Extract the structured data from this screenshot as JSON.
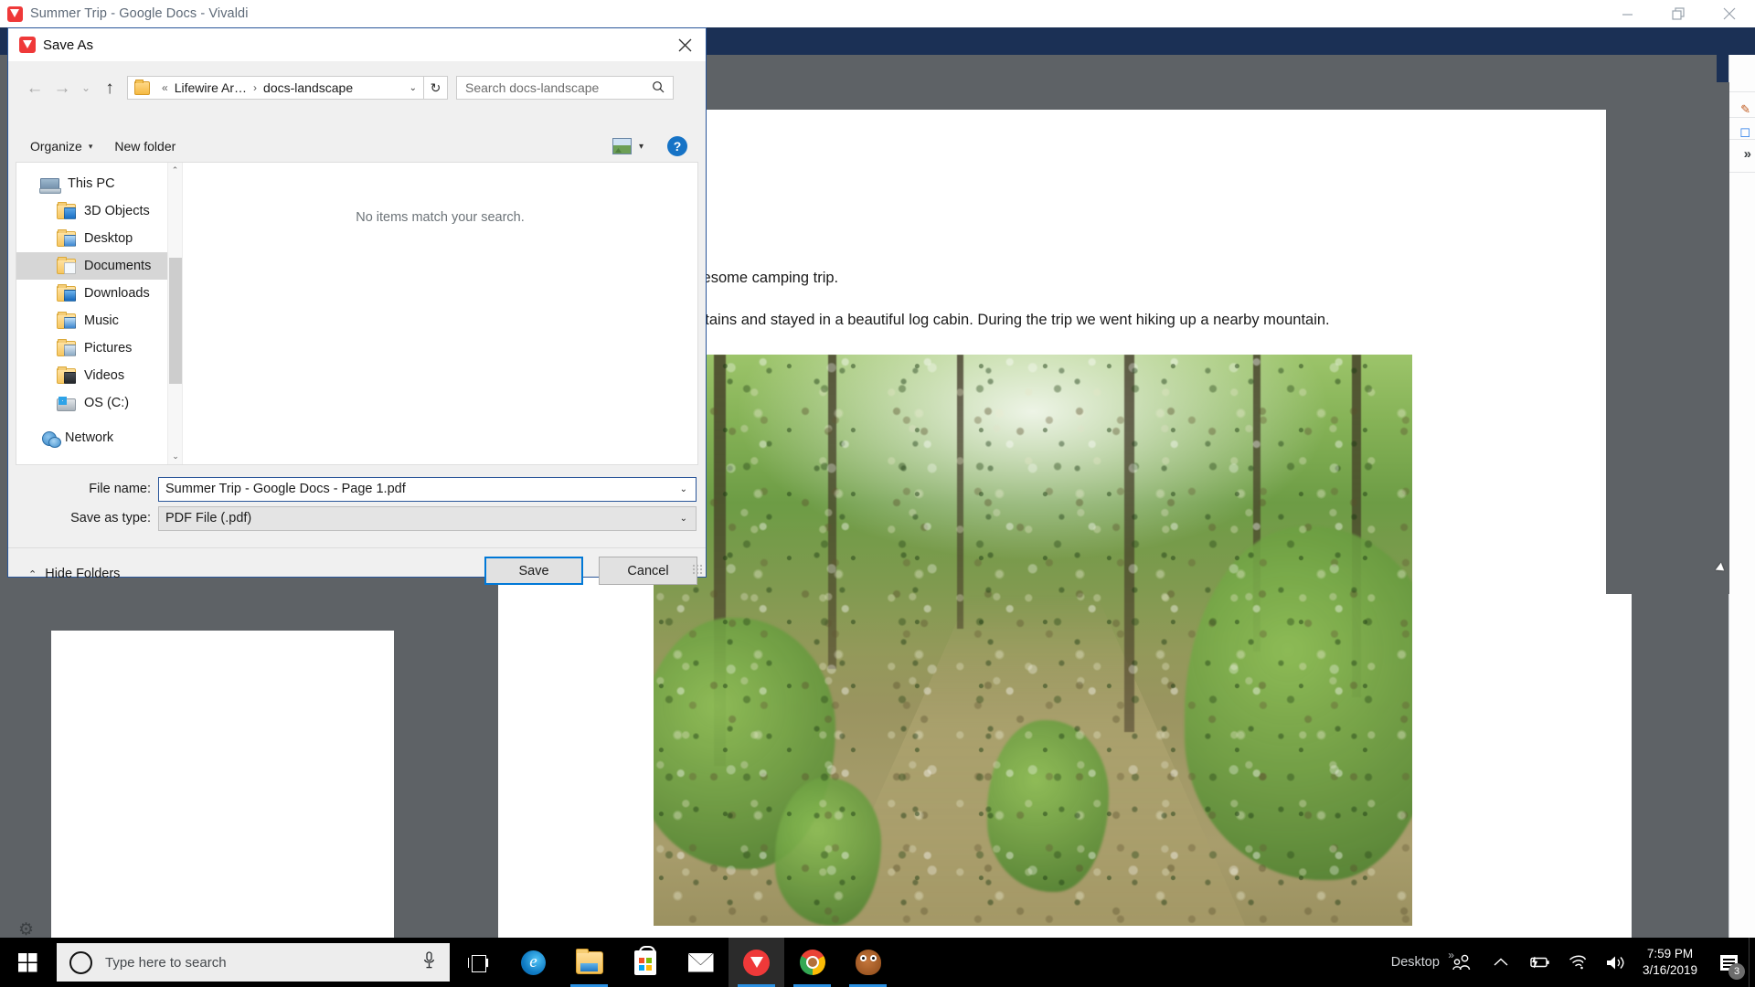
{
  "browser": {
    "title": "Summer Trip - Google Docs - Vivaldi",
    "app_icon": "vivaldi-icon",
    "window_controls": {
      "minimize": "minimize-icon",
      "maximize": "restore-icon",
      "close": "close-icon"
    }
  },
  "document": {
    "paragraph_1": "e took an awesome camping trip.",
    "paragraph_2": "Smoky Mountains and stayed in a beautiful log cabin. During the trip we went hiking up a nearby mountain.",
    "photo_alt": "forest-trail-photo"
  },
  "dialog": {
    "title": "Save As",
    "icon": "vivaldi-icon",
    "close_label": "✕",
    "nav": {
      "back": "←",
      "forward": "→",
      "recent": "⌄",
      "up": "↑",
      "refresh": "↻"
    },
    "address": {
      "folder_icon": "folder-icon",
      "crumb_overflow": "«",
      "crumb_1": "Lifewire Ar…",
      "crumb_sep": "›",
      "crumb_2": "docs-landscape",
      "dropdown_caret": "⌄"
    },
    "search": {
      "placeholder": "Search docs-landscape",
      "icon": "search-icon"
    },
    "commandbar": {
      "organize": "Organize",
      "organize_caret": "▾",
      "new_folder": "New folder",
      "view_icon": "view-layout-icon",
      "view_caret": "▾",
      "help": "?"
    },
    "nav_tree": [
      {
        "label": "This PC",
        "icon": "computer-icon",
        "level": 0,
        "selected": false
      },
      {
        "label": "3D Objects",
        "icon": "folder-3d-objects-icon",
        "level": 1,
        "selected": false
      },
      {
        "label": "Desktop",
        "icon": "folder-desktop-icon",
        "level": 1,
        "selected": false
      },
      {
        "label": "Documents",
        "icon": "folder-documents-icon",
        "level": 1,
        "selected": true
      },
      {
        "label": "Downloads",
        "icon": "folder-downloads-icon",
        "level": 1,
        "selected": false
      },
      {
        "label": "Music",
        "icon": "folder-music-icon",
        "level": 1,
        "selected": false
      },
      {
        "label": "Pictures",
        "icon": "folder-pictures-icon",
        "level": 1,
        "selected": false
      },
      {
        "label": "Videos",
        "icon": "folder-videos-icon",
        "level": 1,
        "selected": false
      },
      {
        "label": "OS (C:)",
        "icon": "drive-icon",
        "level": 1,
        "selected": false
      },
      {
        "label": "Network",
        "icon": "network-icon",
        "level": 0,
        "selected": false
      }
    ],
    "scrollbar": {
      "up_arrow": "⌃",
      "down_arrow": "⌄"
    },
    "file_list": {
      "empty_message": "No items match your search."
    },
    "form": {
      "filename_label": "File name:",
      "filename_value": "Summer Trip - Google Docs - Page 1.pdf",
      "savetype_label": "Save as type:",
      "savetype_value": "PDF File (.pdf)",
      "caret": "⌄"
    },
    "footer": {
      "hide_folders": "Hide Folders",
      "hide_folders_caret": "⌃",
      "save_button": "Save",
      "cancel_button": "Cancel"
    }
  },
  "side_panel": {
    "expand_icon": "chevron-double-right-icon",
    "expand_glyph": "»"
  },
  "taskbar": {
    "start_label": "windows-start-icon",
    "search_placeholder": "Type here to search",
    "cortana_icon": "cortana-icon",
    "mic_icon": "microphone-icon",
    "mic_glyph": "⚇",
    "pinned": [
      {
        "name": "task-view-icon",
        "label": "Task View",
        "open": false
      },
      {
        "name": "edge-icon",
        "label": "Microsoft Edge",
        "open": false
      },
      {
        "name": "file-explorer-icon",
        "label": "File Explorer",
        "open": true
      },
      {
        "name": "microsoft-store-icon",
        "label": "Microsoft Store",
        "open": false
      },
      {
        "name": "mail-icon",
        "label": "Mail",
        "open": false
      },
      {
        "name": "vivaldi-icon",
        "label": "Vivaldi",
        "open": true
      },
      {
        "name": "chrome-icon",
        "label": "Google Chrome",
        "open": true
      },
      {
        "name": "gimp-icon",
        "label": "GIMP",
        "open": true
      }
    ],
    "tray": {
      "desktop_label": "Desktop",
      "overflow_glyph": "»",
      "people_icon": "people-icon",
      "chevron_icon": "show-hidden-icons-icon",
      "chevron_glyph": "⌃",
      "battery_icon": "battery-charging-icon",
      "network_icon": "wifi-icon",
      "volume_icon": "volume-icon",
      "time": "7:59 PM",
      "date": "3/16/2019",
      "notification_icon": "action-center-icon",
      "notification_count": "3"
    }
  },
  "colors": {
    "accent_blue": "#0078d7",
    "dialog_border": "#2a5699",
    "chrome_bar": "#1b3055",
    "vivaldi_red": "#ef3939",
    "selection_gray": "#d6d6d6",
    "taskbar_black": "#000000"
  }
}
